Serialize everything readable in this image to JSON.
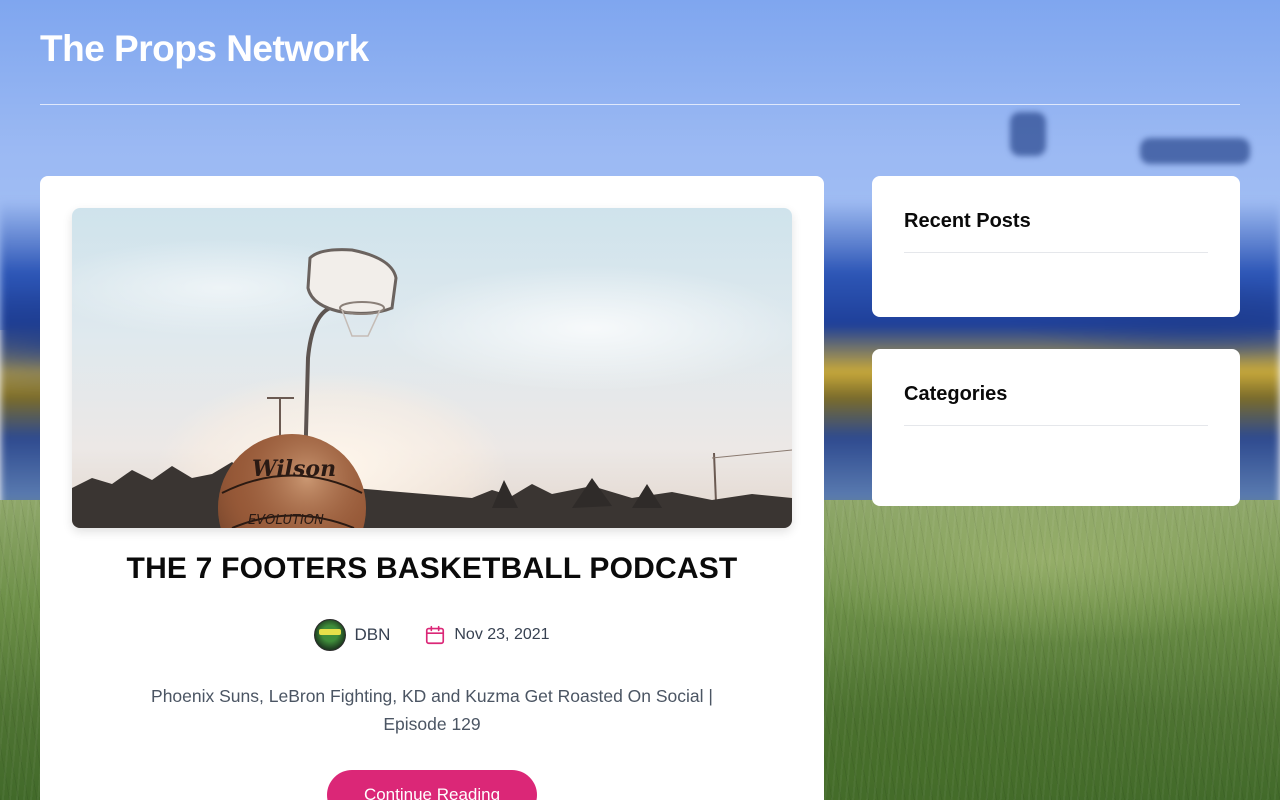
{
  "site": {
    "title": "The Props Network"
  },
  "post": {
    "title": "THE 7 FOOTERS BASKETBALL PODCAST",
    "author": "DBN",
    "date": "Nov 23, 2021",
    "excerpt": "Phoenix Suns, LeBron Fighting, KD and Kuzma Get Roasted On Social | Episode 129",
    "continue_label": "Continue Reading",
    "image_icon": "basketball-hoop-photo",
    "ball_text": "Wilson",
    "ball_subtext": "EVOLUTION"
  },
  "sidebar": {
    "recent_posts_title": "Recent Posts",
    "categories_title": "Categories"
  },
  "colors": {
    "accent": "#db2777",
    "card_bg": "#ffffff",
    "title_text": "#0a0a0a"
  },
  "icons": {
    "calendar": "calendar-icon",
    "avatar": "author-avatar"
  }
}
